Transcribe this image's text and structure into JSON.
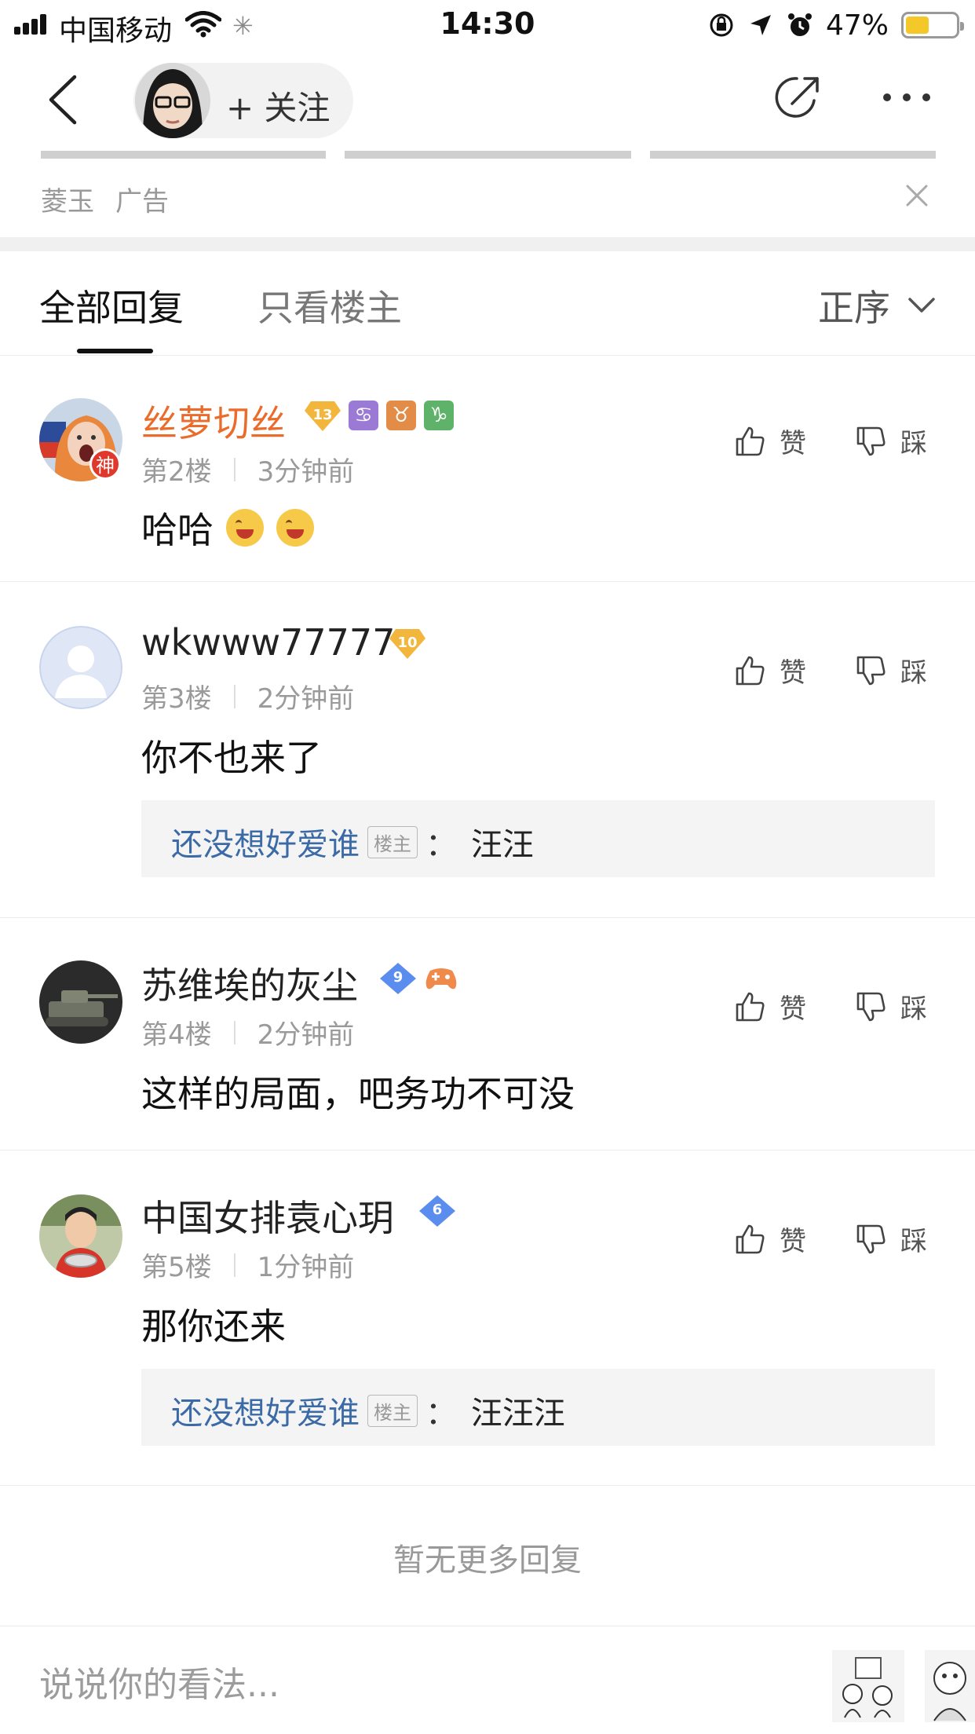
{
  "status_bar": {
    "carrier": "中国移动",
    "time": "14:30",
    "battery_percent": "47%",
    "battery_level": 0.47
  },
  "header": {
    "follow_label": "+ 关注",
    "icons": [
      "back-icon",
      "share-icon",
      "more-icon"
    ]
  },
  "ad": {
    "source": "菱玉",
    "tag": "广告"
  },
  "tabs": {
    "all": "全部回复",
    "op_only": "只看楼主",
    "sort": "正序"
  },
  "replies": [
    {
      "username": "丝萝切丝",
      "level": "13",
      "avatar_badge": "神",
      "floor": "第2楼",
      "time": "3分钟前",
      "content": "哈哈",
      "zodiac": [
        "♋",
        "♉",
        "♑"
      ],
      "like": "赞",
      "dislike": "踩"
    },
    {
      "username": "wkwww77777",
      "level": "10",
      "floor": "第3楼",
      "time": "2分钟前",
      "content": "你不也来了",
      "quote": {
        "user": "还没想好爱谁",
        "tag": "楼主",
        "sep": "：",
        "text": "汪汪"
      },
      "like": "赞",
      "dislike": "踩"
    },
    {
      "username": "苏维埃的灰尘",
      "level": "9",
      "floor": "第4楼",
      "time": "2分钟前",
      "content": "这样的局面，吧务功不可没",
      "like": "赞",
      "dislike": "踩"
    },
    {
      "username": "中国女排袁心玥",
      "level": "6",
      "floor": "第5楼",
      "time": "1分钟前",
      "content": "那你还来",
      "quote": {
        "user": "还没想好爱谁",
        "tag": "楼主",
        "sep": "：",
        "text": "汪汪汪"
      },
      "like": "赞",
      "dislike": "踩"
    }
  ],
  "no_more": "暂无更多回复",
  "comment_box": {
    "placeholder": "说说你的看法..."
  },
  "colors": {
    "username_highlight": "#ea6b2a",
    "quote_user": "#3b6aa6",
    "level_gold": "#f2b63c",
    "level_blue": "#5b8def",
    "battery": "#f5c82a"
  }
}
